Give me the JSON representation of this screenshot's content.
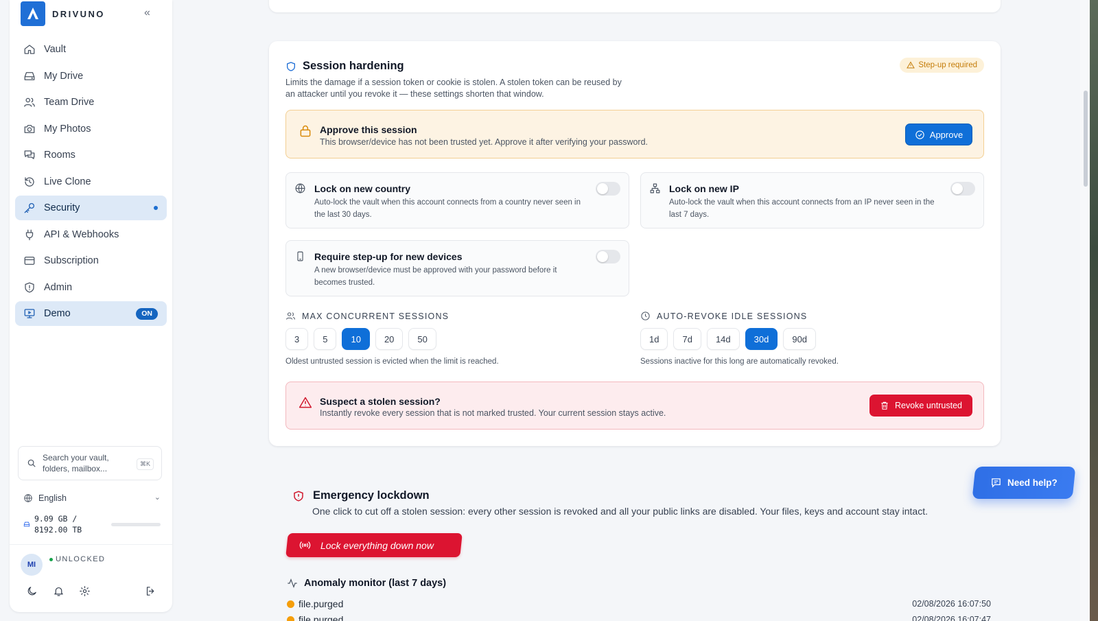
{
  "brand": {
    "name": "DRIVUNO"
  },
  "sidebar": {
    "items": [
      {
        "label": "Vault",
        "icon": "home-icon"
      },
      {
        "label": "My Drive",
        "icon": "drive-icon"
      },
      {
        "label": "Team Drive",
        "icon": "users-icon"
      },
      {
        "label": "My Photos",
        "icon": "camera-icon"
      },
      {
        "label": "Rooms",
        "icon": "chat-icon"
      },
      {
        "label": "Live Clone",
        "icon": "history-icon"
      },
      {
        "label": "Security",
        "icon": "key-icon",
        "active": true
      },
      {
        "label": "API & Webhooks",
        "icon": "plug-icon"
      },
      {
        "label": "Subscription",
        "icon": "card-icon"
      },
      {
        "label": "Admin",
        "icon": "shield-icon"
      },
      {
        "label": "Demo",
        "icon": "monitor-icon",
        "badge": "ON"
      }
    ],
    "search_placeholder": "Search your vault, folders, mailbox...",
    "search_shortcut": "⌘K",
    "language": "English",
    "storage_used": "9.09 GB /",
    "storage_total": "8192.00 TB",
    "storage_fraction": 0.0,
    "user_initials": "MI",
    "lock_status": "UNLOCKED"
  },
  "session": {
    "title": "Session hardening",
    "desc": "Limits the damage if a session token or cookie is stolen. A stolen token can be reused by an attacker until you revoke it — these settings shorten that window.",
    "badge": "Step-up required",
    "approve": {
      "title": "Approve this session",
      "desc": "This browser/device has not been trusted yet. Approve it after verifying your password.",
      "button": "Approve"
    },
    "options": [
      {
        "title": "Lock on new country",
        "desc": "Auto-lock the vault when this account connects from a country never seen in the last 30 days.",
        "enabled": false
      },
      {
        "title": "Lock on new IP",
        "desc": "Auto-lock the vault when this account connects from an IP never seen in the last 7 days.",
        "enabled": false
      },
      {
        "title": "Require step-up for new devices",
        "desc": "A new browser/device must be approved with your password before it becomes trusted.",
        "enabled": false
      }
    ],
    "max_sessions": {
      "label": "MAX CONCURRENT SESSIONS",
      "values": [
        "3",
        "5",
        "10",
        "20",
        "50"
      ],
      "selected": "10",
      "hint": "Oldest untrusted session is evicted when the limit is reached."
    },
    "auto_revoke": {
      "label": "AUTO-REVOKE IDLE SESSIONS",
      "values": [
        "1d",
        "7d",
        "14d",
        "30d",
        "90d"
      ],
      "selected": "30d",
      "hint": "Sessions inactive for this long are automatically revoked."
    },
    "suspect": {
      "title": "Suspect a stolen session?",
      "desc": "Instantly revoke every session that is not marked trusted. Your current session stays active.",
      "button": "Revoke untrusted"
    }
  },
  "emergency": {
    "title": "Emergency lockdown",
    "desc": "One click to cut off a stolen session: every other session is revoked and all your public links are disabled. Your files, keys and account stay intact.",
    "button": "Lock everything down now"
  },
  "anomaly": {
    "title": "Anomaly monitor (last 7 days)",
    "rows": [
      {
        "event": "file.purged",
        "time": "02/08/2026 16:07:50"
      },
      {
        "event": "file.purged",
        "time": "02/08/2026 16:07:47"
      }
    ]
  },
  "help": {
    "label": "Need help?"
  },
  "colors": {
    "accent": "#0f6fd8",
    "danger": "#dc1431",
    "warning": "#d98b0b"
  }
}
